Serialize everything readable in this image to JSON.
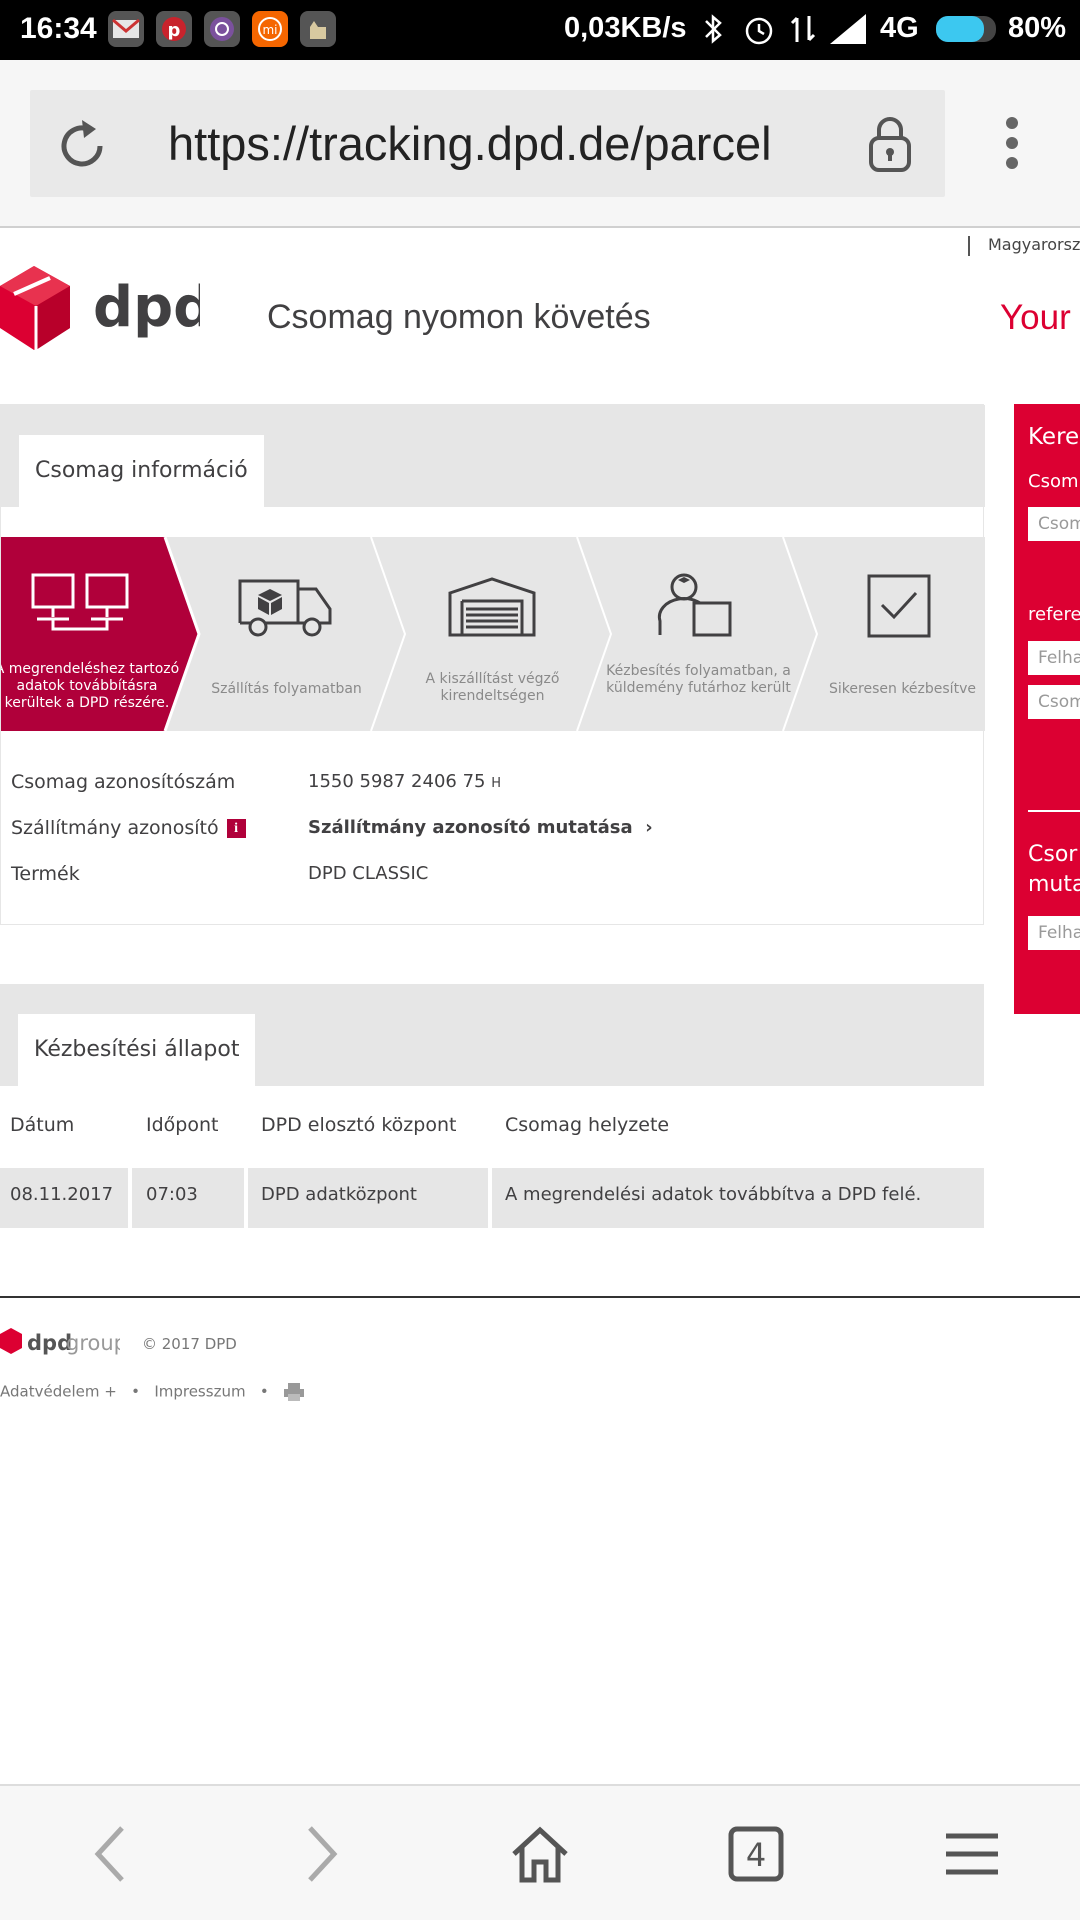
{
  "status_bar": {
    "time": "16:34",
    "net_speed": "0,03KB/s",
    "network": "4G",
    "battery_percent": "80%",
    "battery_level": 0.8,
    "apps": [
      "gmail-icon",
      "pinterest-icon",
      "viber-icon",
      "mi-icon",
      "alpaca-icon"
    ],
    "mi_label": "mi"
  },
  "browser": {
    "url": "https://tracking.dpd.de/parcel",
    "tab_count": "4"
  },
  "header": {
    "country": "Magyarorsz",
    "logo_text": "dpd",
    "title": "Csomag nyomon követés",
    "your_link": "Your"
  },
  "package_info": {
    "tab_label": "Csomag információ",
    "steps": [
      {
        "label": "A megrendeléshez tartozó adatok továbbításra kerültek a DPD részére.",
        "active": true
      },
      {
        "label": "Szállítás folyamatban",
        "active": false
      },
      {
        "label": "A kiszállítást végző kirendeltségen",
        "active": false
      },
      {
        "label": "Kézbesítés folyamatban, a küldemény futárhoz került",
        "active": false
      },
      {
        "label": "Sikeresen kézbesítve",
        "active": false
      }
    ],
    "rows": {
      "parcel_id_label": "Csomag azonosítószám",
      "parcel_id_value": "1550 5987 2406 75",
      "parcel_id_suffix": "H",
      "shipment_id_label": "Szállítmány azonosító",
      "shipment_info_badge": "i",
      "shipment_id_value": "Szállítmány azonosító mutatása",
      "shipment_chevron": "›",
      "product_label": "Termék",
      "product_value": "DPD CLASSIC"
    }
  },
  "delivery_status": {
    "tab_label": "Kézbesítési állapot",
    "columns": [
      "Dátum",
      "Időpont",
      "DPD elosztó központ",
      "Csomag helyzete"
    ],
    "rows": [
      {
        "date": "08.11.2017",
        "time": "07:03",
        "depot": "DPD adatközpont",
        "status": "A megrendelési adatok továbbítva a DPD felé."
      }
    ]
  },
  "side_panel": {
    "title": "Kere",
    "label1": "Csom",
    "input1_placeholder": "Csom",
    "label2": "refere",
    "input2_placeholder": "Felha",
    "input3_placeholder": "Csom",
    "title2_line1": "Csor",
    "title2_line2": "muta",
    "input4_placeholder": "Felha"
  },
  "footer": {
    "logo_dpd": "dpd",
    "logo_group": "group",
    "copyright": "© 2017 DPD",
    "privacy": "Adatvédelem",
    "privacy_plus": "+",
    "separator": "•",
    "imprint": "Impresszum"
  },
  "colors": {
    "brand_red": "#dc0032",
    "active_step": "#b0003a",
    "grey": "#e6e6e6"
  }
}
